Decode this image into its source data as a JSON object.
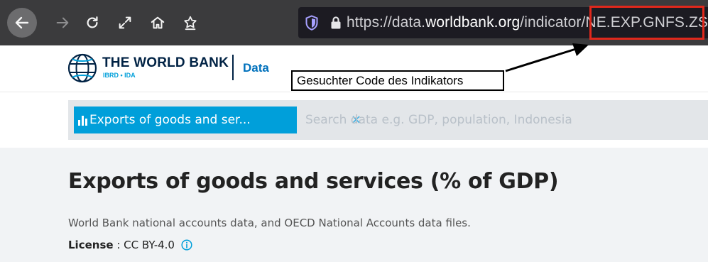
{
  "browser": {
    "url_prefix": "https://data.",
    "url_host": "worldbank.org",
    "url_path": "/indicator",
    "url_code": "/NE.EXP.GNFS.ZS",
    "icons": [
      "back-arrow-icon",
      "forward-arrow-icon",
      "reload-icon",
      "expand-icon",
      "home-icon",
      "bookmark-star-icon",
      "shield-icon",
      "lock-icon"
    ],
    "highlight_color": "#e0281c"
  },
  "header": {
    "brand": "THE WORLD BANK",
    "brand_sub": "IBRD • IDA",
    "section_link": "Data"
  },
  "annotation": {
    "text": "Gesuchter Code des Indikators"
  },
  "search": {
    "chip_label": "Exports of goods and ser...",
    "chip_close": "×",
    "placeholder": "Search data e.g. GDP, population, Indonesia",
    "chip_color": "#009fda"
  },
  "main": {
    "title": "Exports of goods and services (% of GDP)",
    "source": "World Bank national accounts data, and OECD National Accounts data files.",
    "license_label": "License",
    "license_separator": " : ",
    "license_value": "CC BY-4.0"
  }
}
